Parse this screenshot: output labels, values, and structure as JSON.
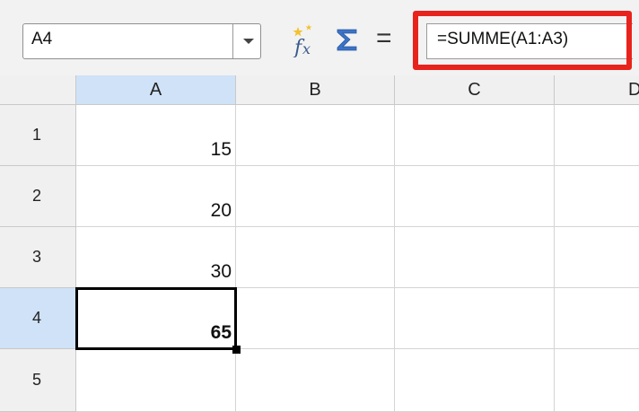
{
  "formula_bar": {
    "name_box": "A4",
    "formula": "=SUMME(A1:A3)",
    "equal_sign": "=",
    "icons": {
      "dropdown": "chevron-down-icon",
      "function_wizard": "function-wizard-icon",
      "sum": "sum-icon"
    },
    "highlight_color": "#e8231d"
  },
  "sheet": {
    "columns": [
      "A",
      "B",
      "C",
      "D"
    ],
    "rows": [
      "1",
      "2",
      "3",
      "4",
      "5"
    ],
    "cells": {
      "A1": "15",
      "A2": "20",
      "A3": "30",
      "A4": "65"
    },
    "selected_cell": "A4",
    "selection_header_color": "#cfe2f7"
  }
}
